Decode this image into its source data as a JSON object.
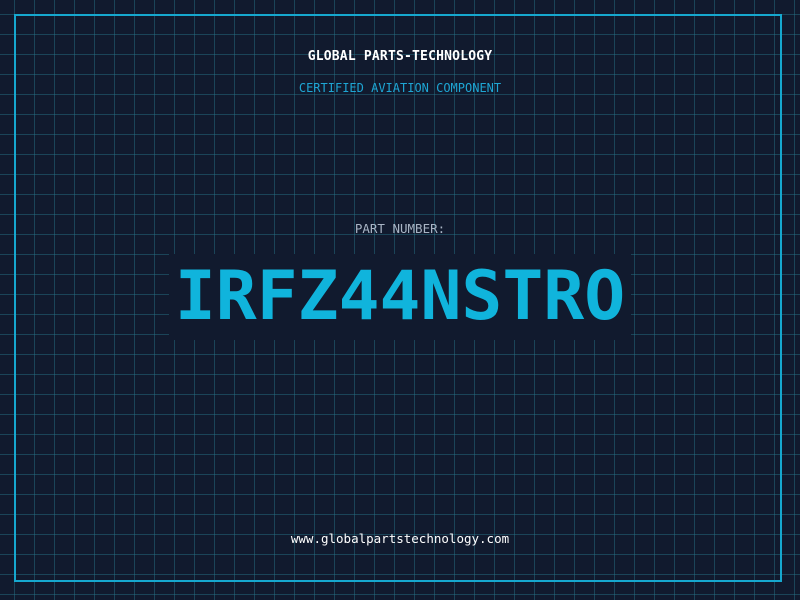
{
  "header": {
    "company": "GLOBAL PARTS-TECHNOLOGY",
    "subtitle": "CERTIFIED AVIATION COMPONENT"
  },
  "main": {
    "part_label": "PART NUMBER:",
    "part_number": "IRFZ44NSTRO"
  },
  "footer": {
    "website": "www.globalpartstechnology.com"
  },
  "colors": {
    "background": "#111a2e",
    "grid": "#28788c",
    "accent": "#16a8cf",
    "part_number": "#10b4dc",
    "label": "#a8b4c4",
    "text": "#ffffff"
  }
}
